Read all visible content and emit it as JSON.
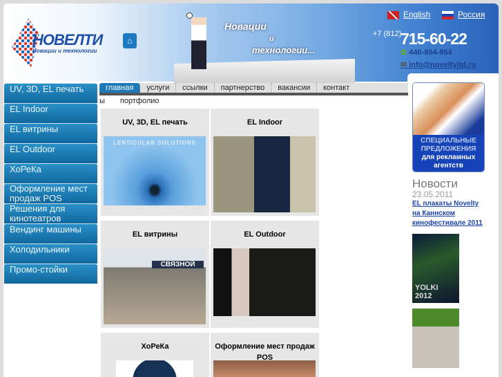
{
  "header": {
    "brand": "НОВЕЛТИ",
    "tagline": "Новации и технологии",
    "slogan": [
      "Новации",
      "и",
      "технологии..."
    ],
    "languages": [
      "English",
      "Россия"
    ],
    "phone_code": "+7 (812)",
    "phone": "715-60-22",
    "icq": "440-854-854",
    "email": "info@noveltyltd.ru"
  },
  "sidebar": [
    "UV, 3D, EL печать",
    "EL Indoor",
    "EL витрины",
    "EL Outdoor",
    "ХоРеКа",
    "Оформление мест продаж POS",
    "Решения для кинотеатров",
    "Вендинг машины",
    "Холодильники",
    "Промо-стойки"
  ],
  "nav": {
    "items": [
      "главная",
      "услуги",
      "ссылки",
      "партнерство",
      "вакансии",
      "контакт"
    ],
    "wrap": "ы",
    "wrap2": "портфолио"
  },
  "grid": [
    {
      "title": "UV, 3D, EL печать",
      "image_text": "LENTICULAR SOLUTIONS"
    },
    {
      "title": "EL Indoor"
    },
    {
      "title": "EL витрины",
      "image_text": "СВЯЗНОЙ"
    },
    {
      "title": "EL Outdoor"
    },
    {
      "title": "ХоРеКа"
    },
    {
      "title": "Оформление мест продаж POS"
    }
  ],
  "promo": {
    "line1": "СПЕЦИАЛЬНЫЕ",
    "line2": "ПРЕДЛОЖЕНИЯ",
    "line3": "для рекламных",
    "line4": "агентств"
  },
  "news": {
    "heading": "Новости",
    "date": "23.05.2011",
    "link": "EL плакаты Novelty на Каннском кинофестивале 2011",
    "poster_text": "YOLKI 2012"
  }
}
